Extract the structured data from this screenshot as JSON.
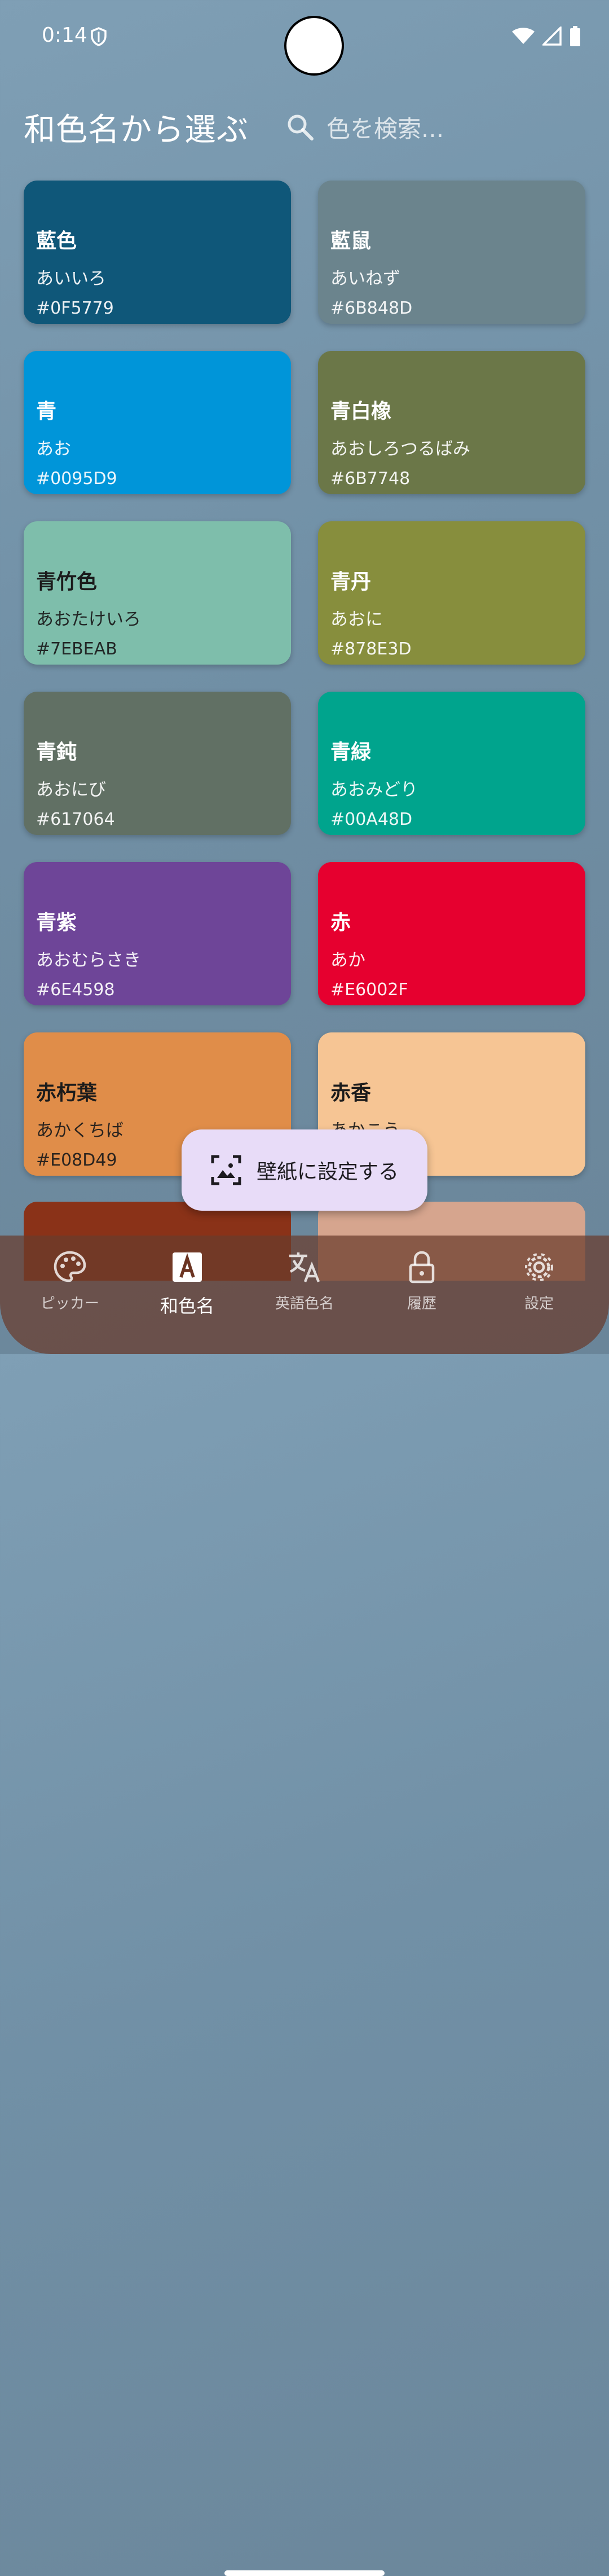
{
  "status": {
    "time": "0:14"
  },
  "header": {
    "title": "和色名から選ぶ",
    "search_placeholder": "色を検索..."
  },
  "colors": [
    {
      "name": "藍色",
      "kana": "あいいろ",
      "hex": "#0F5779",
      "text": "light"
    },
    {
      "name": "藍鼠",
      "kana": "あいねず",
      "hex": "#6B848D",
      "text": "light"
    },
    {
      "name": "青",
      "kana": "あお",
      "hex": "#0095D9",
      "text": "light"
    },
    {
      "name": "青白橡",
      "kana": "あおしろつるばみ",
      "hex": "#6B7748",
      "text": "light"
    },
    {
      "name": "青竹色",
      "kana": "あおたけいろ",
      "hex": "#7EBEAB",
      "text": "dark"
    },
    {
      "name": "青丹",
      "kana": "あおに",
      "hex": "#878E3D",
      "text": "light"
    },
    {
      "name": "青鈍",
      "kana": "あおにび",
      "hex": "#617064",
      "text": "light"
    },
    {
      "name": "青緑",
      "kana": "あおみどり",
      "hex": "#00A48D",
      "text": "light"
    },
    {
      "name": "青紫",
      "kana": "あおむらさき",
      "hex": "#6E4598",
      "text": "light"
    },
    {
      "name": "赤",
      "kana": "あか",
      "hex": "#E6002F",
      "text": "light"
    },
    {
      "name": "赤朽葉",
      "kana": "あかくちば",
      "hex": "#E08D49",
      "text": "dark"
    },
    {
      "name": "赤香",
      "kana": "あかこう",
      "hex": "#F6C594",
      "text": "dark"
    }
  ],
  "partial_row_colors": [
    "#8A3218",
    "#D6A58E"
  ],
  "fab": {
    "label": "壁紙に設定する",
    "icon": "wallpaper-icon"
  },
  "nav": [
    {
      "label": "ピッカー",
      "icon": "palette-icon"
    },
    {
      "label": "和色名",
      "icon": "letter-a-icon",
      "active": true
    },
    {
      "label": "英語色名",
      "icon": "translate-icon"
    },
    {
      "label": "履歴",
      "icon": "lock-icon"
    },
    {
      "label": "設定",
      "icon": "gear-icon"
    }
  ]
}
